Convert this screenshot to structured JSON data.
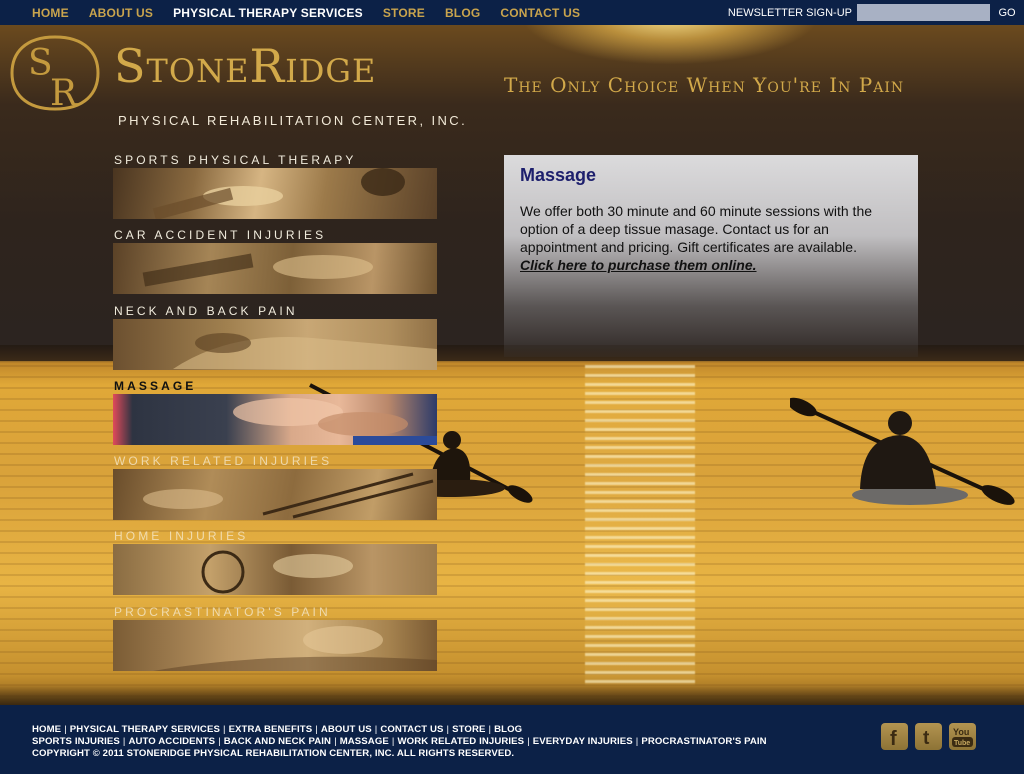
{
  "top_nav": {
    "links": [
      {
        "label": "HOME",
        "active": false
      },
      {
        "label": "ABOUT US",
        "active": false
      },
      {
        "label": "PHYSICAL THERAPY SERVICES",
        "active": true
      },
      {
        "label": "STORE",
        "active": false
      },
      {
        "label": "BLOG",
        "active": false
      },
      {
        "label": "CONTACT US",
        "active": false
      }
    ],
    "newsletter_label": "NEWSLETTER SIGN-UP",
    "newsletter_value": "",
    "go_label": "GO"
  },
  "logo": {
    "wordmark": "StoneRidge",
    "subline": "PHYSICAL REHABILITATION CENTER, INC."
  },
  "tagline": "The Only Choice When You're In Pain",
  "services": [
    {
      "label": "SPORTS PHYSICAL THERAPY",
      "active": false
    },
    {
      "label": "CAR ACCIDENT INJURIES",
      "active": false
    },
    {
      "label": "NECK AND BACK PAIN",
      "active": false
    },
    {
      "label": "MASSAGE",
      "active": true
    },
    {
      "label": "WORK RELATED INJURIES",
      "active": false
    },
    {
      "label": "HOME INJURIES",
      "active": false
    },
    {
      "label": "PROCRASTINATOR'S PAIN",
      "active": false
    }
  ],
  "content": {
    "title": "Massage",
    "body": "We offer both 30 minute and 60 minute sessions with the option of a deep tissue masage. Contact us for an appointment and pricing. Gift certificates are available.",
    "link_text": "Click here to purchase them online."
  },
  "footer": {
    "row1": [
      "HOME",
      "PHYSICAL THERAPY SERVICES",
      "EXTRA BENEFITS",
      "ABOUT US",
      "CONTACT US",
      "STORE",
      "BLOG"
    ],
    "row2": [
      "SPORTS INJURIES",
      "AUTO ACCIDENTS",
      "BACK AND NECK PAIN",
      "MASSAGE",
      "WORK RELATED INJURIES",
      "EVERYDAY INJURIES",
      "PROCRASTINATOR'S PAIN"
    ],
    "copyright": "COPYRIGHT © 2011 STONERIDGE PHYSICAL REHABILITATION CENTER, INC. ALL RIGHTS RESERVED.",
    "social": [
      {
        "icon": "facebook-icon",
        "glyph": "f"
      },
      {
        "icon": "twitter-icon",
        "glyph": "t"
      },
      {
        "icon": "youtube-icon",
        "glyph_top": "You",
        "glyph_bottom": "Tube"
      }
    ]
  },
  "colors": {
    "nav_bg": "#0c2147",
    "nav_link": "#c9a44d",
    "nav_active": "#ffffff",
    "gold": "#d2a94a",
    "content_title": "#1d1f6d"
  }
}
